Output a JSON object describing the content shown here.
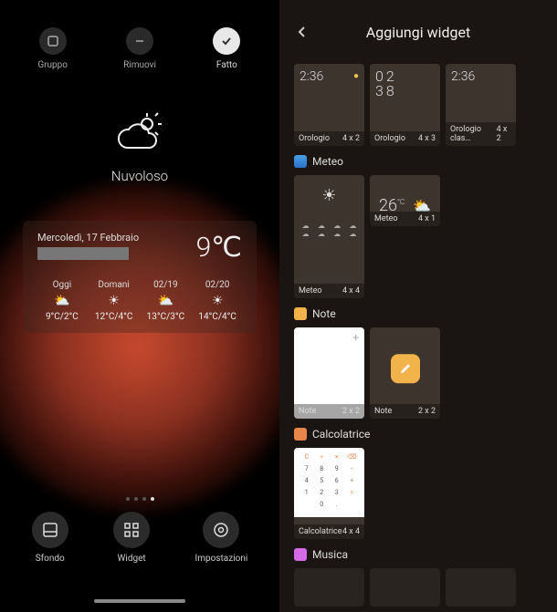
{
  "left": {
    "top": {
      "group": "Gruppo",
      "remove": "Rimuovi",
      "done": "Fatto"
    },
    "weather": {
      "condition": "Nuvoloso",
      "date": "Mercoledì, 17 Febbraio",
      "temp": "9℃",
      "days": [
        {
          "label": "Oggi",
          "icon": "partly-cloudy",
          "temp": "9°C/2°C"
        },
        {
          "label": "Domani",
          "icon": "sunny",
          "temp": "12°C/4°C"
        },
        {
          "label": "02/19",
          "icon": "partly-cloudy",
          "temp": "13°C/3°C"
        },
        {
          "label": "02/20",
          "icon": "sunny",
          "temp": "14°C/4°C"
        }
      ]
    },
    "page_dots": {
      "count": 4,
      "active": 3
    },
    "bottom": {
      "wallpaper": "Sfondo",
      "widget": "Widget",
      "settings": "Impostazioni"
    }
  },
  "right": {
    "title": "Aggiungi widget",
    "clock": {
      "time": "2:36",
      "time_stacked_a": "02",
      "time_stacked_b": "38",
      "widgets": [
        {
          "name": "Orologio",
          "size": "4 x 2"
        },
        {
          "name": "Orologio",
          "size": "4 x 3"
        },
        {
          "name": "Orologio clas…",
          "size": "4 x 2"
        }
      ]
    },
    "meteo": {
      "section": "Meteo",
      "temp": "26",
      "unit": "°C",
      "widgets": [
        {
          "name": "Meteo",
          "size": "4 x 4"
        },
        {
          "name": "Meteo",
          "size": "4 x 1"
        }
      ]
    },
    "note": {
      "section": "Note",
      "widgets": [
        {
          "name": "Note",
          "size": "2 x 2"
        },
        {
          "name": "Note",
          "size": "2 x 2"
        }
      ]
    },
    "calc": {
      "section": "Calcolatrice",
      "keys": [
        "C",
        "÷",
        "×",
        "⌫",
        "7",
        "8",
        "9",
        "−",
        "4",
        "5",
        "6",
        "+",
        "1",
        "2",
        "3",
        "=",
        "",
        "0",
        ".",
        ""
      ],
      "widgets": [
        {
          "name": "Calcolatrice",
          "size": "4 x 4"
        }
      ]
    },
    "music": {
      "section": "Musica"
    }
  }
}
